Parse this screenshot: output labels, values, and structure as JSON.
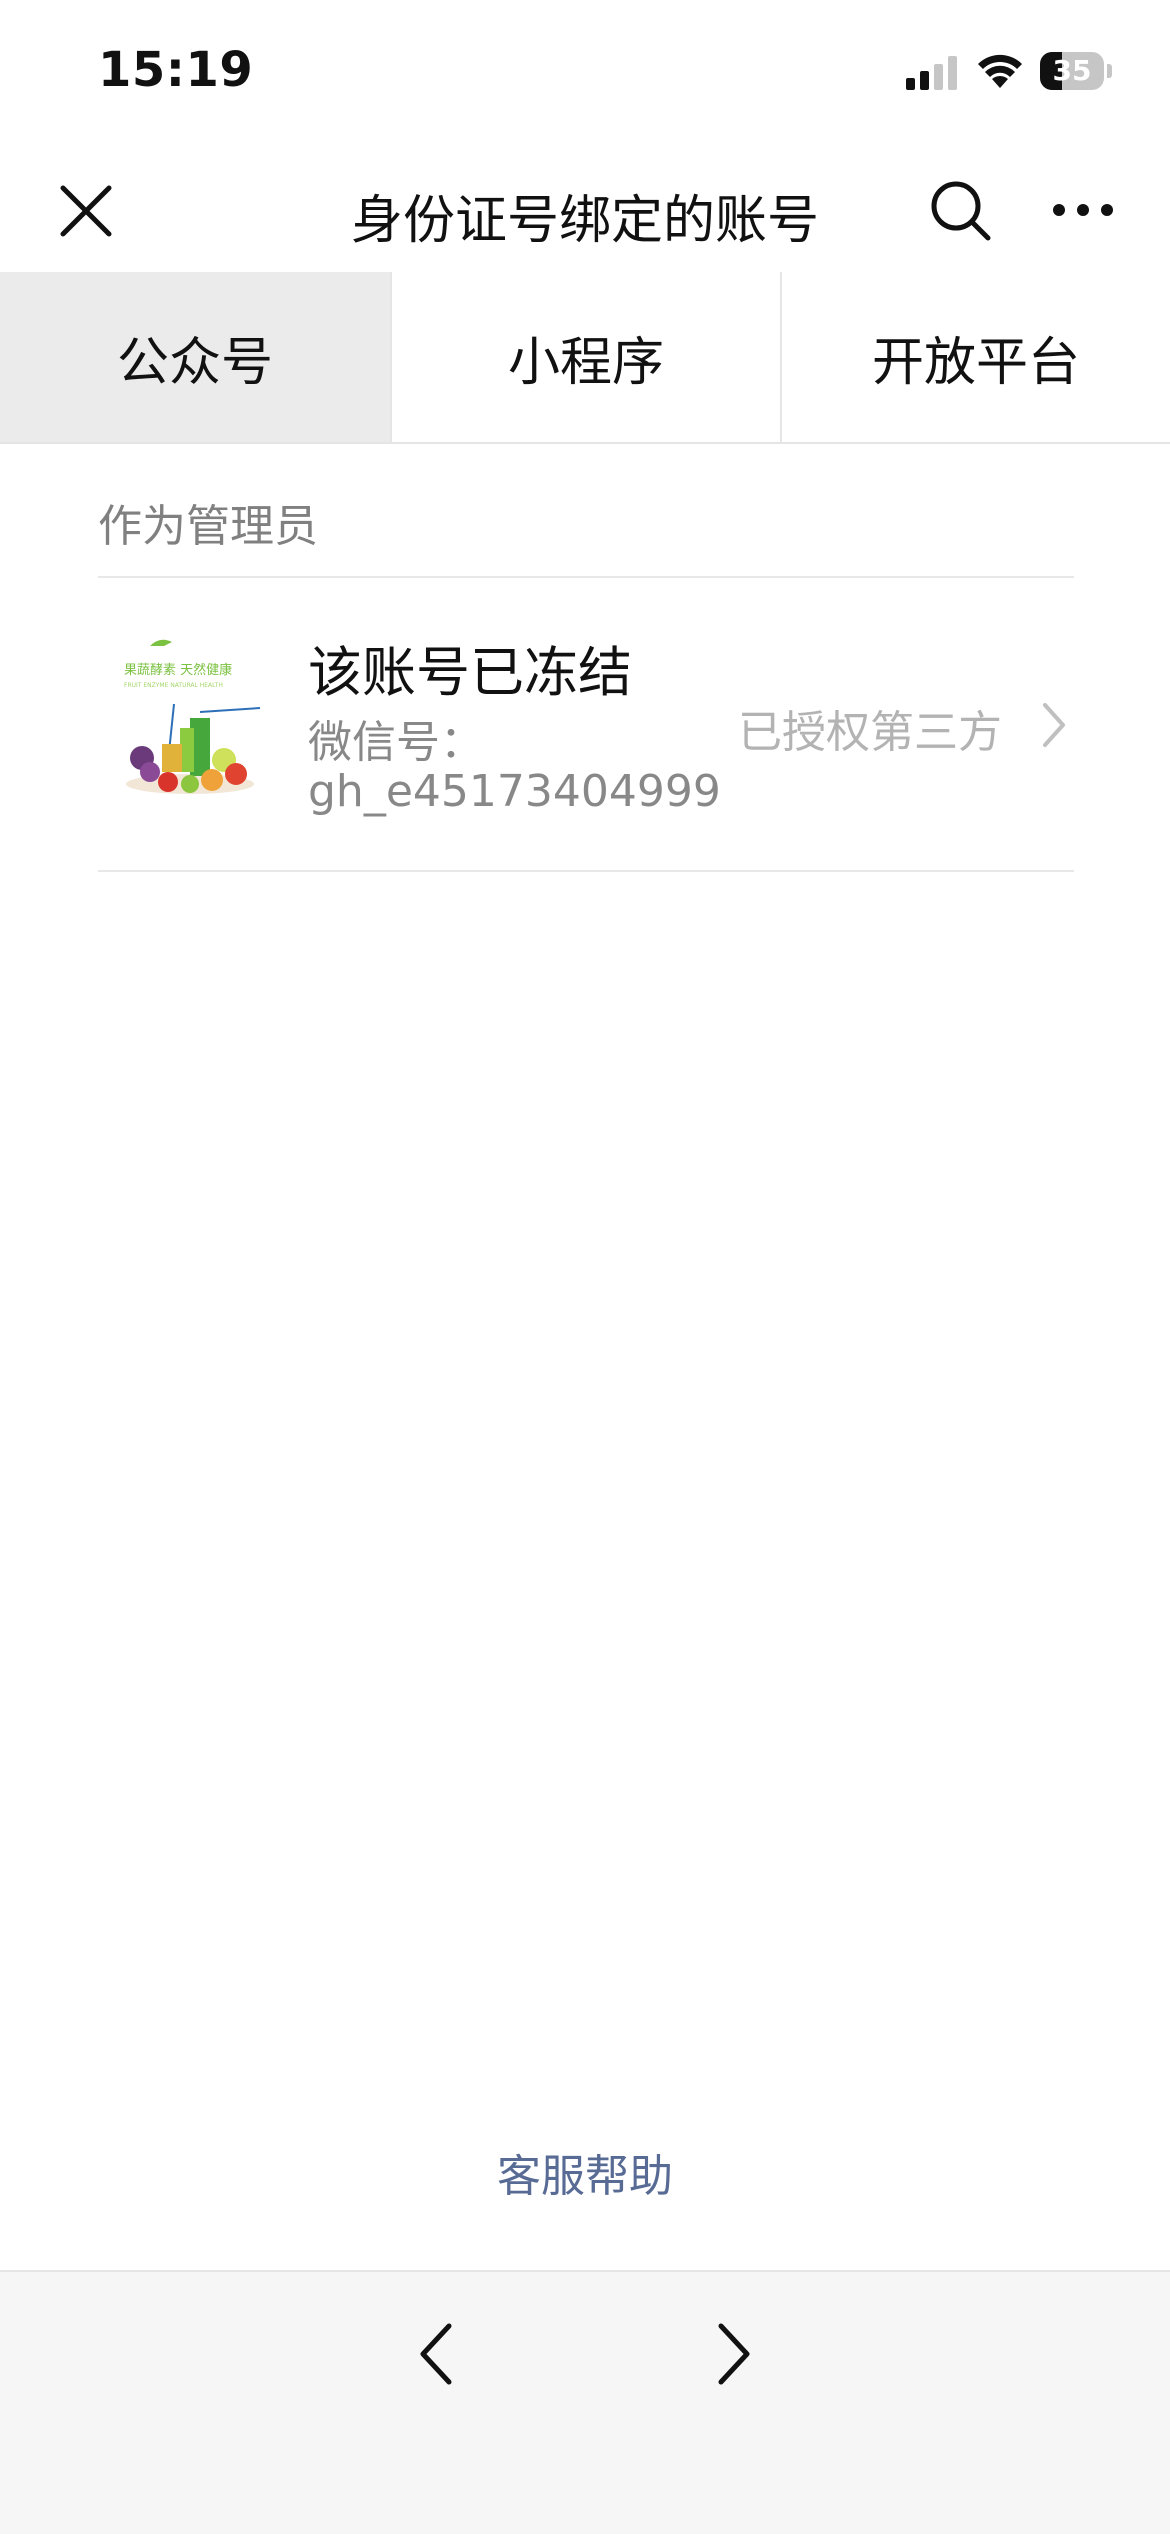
{
  "status_bar": {
    "time": "15:19",
    "battery": "35",
    "battery_level": 0.35
  },
  "nav": {
    "title": "身份证号绑定的账号",
    "icons": {
      "close": "close-icon",
      "search": "search-icon",
      "more": "more-icon"
    }
  },
  "tabs": [
    {
      "label": "公众号",
      "active": true
    },
    {
      "label": "小程序",
      "active": false
    },
    {
      "label": "开放平台",
      "active": false
    }
  ],
  "section": {
    "label": "作为管理员"
  },
  "account": {
    "title": "该账号已冻结",
    "wxid_label": "微信号：",
    "wxid": "gh_e45173404999",
    "status": "已授权第三方",
    "avatar_text": "果蔬酵素 天然健康",
    "avatar_subtext": "FRUIT ENZYME NATURAL HEALTH"
  },
  "help": {
    "label": "客服帮助"
  },
  "colors": {
    "link": "#576b95",
    "tab_active_bg": "#ebebeb",
    "avatar_green": "#7cc242"
  }
}
